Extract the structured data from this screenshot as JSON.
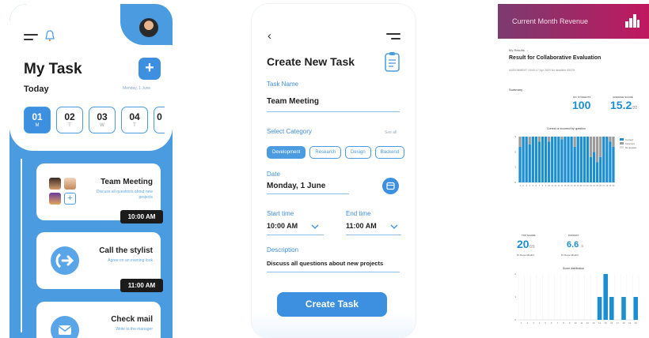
{
  "my_task": {
    "title": "My Task",
    "add_label": "+",
    "today_label": "Today",
    "date_label": "Monday, 1 June",
    "days": [
      {
        "num": "01",
        "letter": "M",
        "active": true
      },
      {
        "num": "02",
        "letter": "T",
        "active": false
      },
      {
        "num": "03",
        "letter": "W",
        "active": false
      },
      {
        "num": "04",
        "letter": "T",
        "active": false
      },
      {
        "num": "0",
        "letter": "",
        "active": false
      }
    ],
    "tasks": [
      {
        "title": "Team Meeting",
        "desc": "Discuss all questions about new projects",
        "time": "10:00 AM"
      },
      {
        "title": "Call the stylist",
        "desc": "Agree on an evening look",
        "time": "11:00 AM"
      },
      {
        "title": "Check mail",
        "desc": "Write to the manager",
        "time": ""
      }
    ],
    "plus_label": "+"
  },
  "create_task": {
    "back_label": "‹",
    "title": "Create New Task",
    "task_name_label": "Task Name",
    "task_name_value": "Team Meeting",
    "category_label": "Select Category",
    "see_all_label": "See all",
    "categories": [
      "Development",
      "Research",
      "Design",
      "Backend"
    ],
    "selected_category": "Development",
    "date_label": "Date",
    "date_value": "Monday, 1 June",
    "start_label": "Start time",
    "start_value": "10:00 AM",
    "end_label": "End time",
    "end_value": "11:00 AM",
    "description_label": "Description",
    "description_value": "Discuss all questions  about new projects",
    "create_button": "Create Task",
    "accent": "#3d8fe0"
  },
  "revenue": {
    "header_title": "Current Month Revenue",
    "crumb": "My Results  →",
    "title": "Result for Collaborative Evaluation",
    "meta": "ASSIGNMENT   10/40    17 Apr 2020    No deadline    95375",
    "summary_label": "Summary",
    "students_label": "NO. STUDENTS",
    "students_value": "100",
    "avg_label": "AVERAGE SCORE",
    "avg_value": "15.2",
    "avg_suffix": "/20",
    "chart1_title": "Correct or incorrect by question",
    "legend": [
      "Correct",
      "Incorrect",
      "No answer"
    ],
    "top_label": "TOP SCORE",
    "top_value": "20",
    "top_suffix": "/20",
    "top_name": "M. Reza Alhallid",
    "fastest_label": "FASTEST",
    "fastest_value": "6.6",
    "fastest_suffix": "s",
    "fastest_name": "M. Reza Alhallid",
    "chart2_title": "Score distribution",
    "header_gradient": [
      "#7b3b6f",
      "#c0185f"
    ],
    "bar_color": "#1d8fd1"
  },
  "chart_data": [
    {
      "type": "bar",
      "title": "Correct or incorrect by question",
      "categories": [
        "1",
        "2",
        "3",
        "4",
        "5",
        "6",
        "7",
        "8",
        "9",
        "10",
        "11",
        "12",
        "13",
        "14",
        "15",
        "16",
        "17",
        "18",
        "19",
        "20",
        "21",
        "22",
        "23",
        "24",
        "25",
        "26",
        "27",
        "28",
        "29",
        "30"
      ],
      "series": [
        {
          "name": "Correct",
          "values": [
            7,
            9,
            9,
            7.5,
            9,
            9,
            8,
            9,
            9,
            8,
            9,
            9,
            9,
            8.5,
            9,
            9,
            9,
            7,
            9,
            9,
            9,
            9,
            5,
            6,
            4,
            5,
            9,
            9,
            8,
            7
          ]
        },
        {
          "name": "Incorrect",
          "values": [
            2,
            0,
            0,
            1.5,
            0,
            0,
            1,
            0,
            0,
            1,
            0,
            0,
            0,
            0.5,
            0,
            0,
            0,
            2,
            0,
            0,
            0,
            0,
            4,
            3,
            5,
            4,
            0,
            0,
            1,
            2
          ]
        }
      ],
      "ylim": [
        0,
        9
      ],
      "stacked": true,
      "legend": "right"
    },
    {
      "type": "bar",
      "title": "Score distribution",
      "categories": [
        "1",
        "2",
        "3",
        "4",
        "5",
        "6",
        "7",
        "8",
        "9",
        "10",
        "11",
        "12",
        "13",
        "14",
        "15",
        "16",
        "17",
        "18",
        "19",
        "20"
      ],
      "values": [
        0,
        0,
        0,
        0,
        0,
        0,
        0,
        0,
        0,
        0,
        0,
        0,
        0,
        1,
        2,
        1,
        0,
        1,
        0,
        1
      ],
      "ylim": [
        0,
        2
      ],
      "ylabel": ""
    }
  ]
}
